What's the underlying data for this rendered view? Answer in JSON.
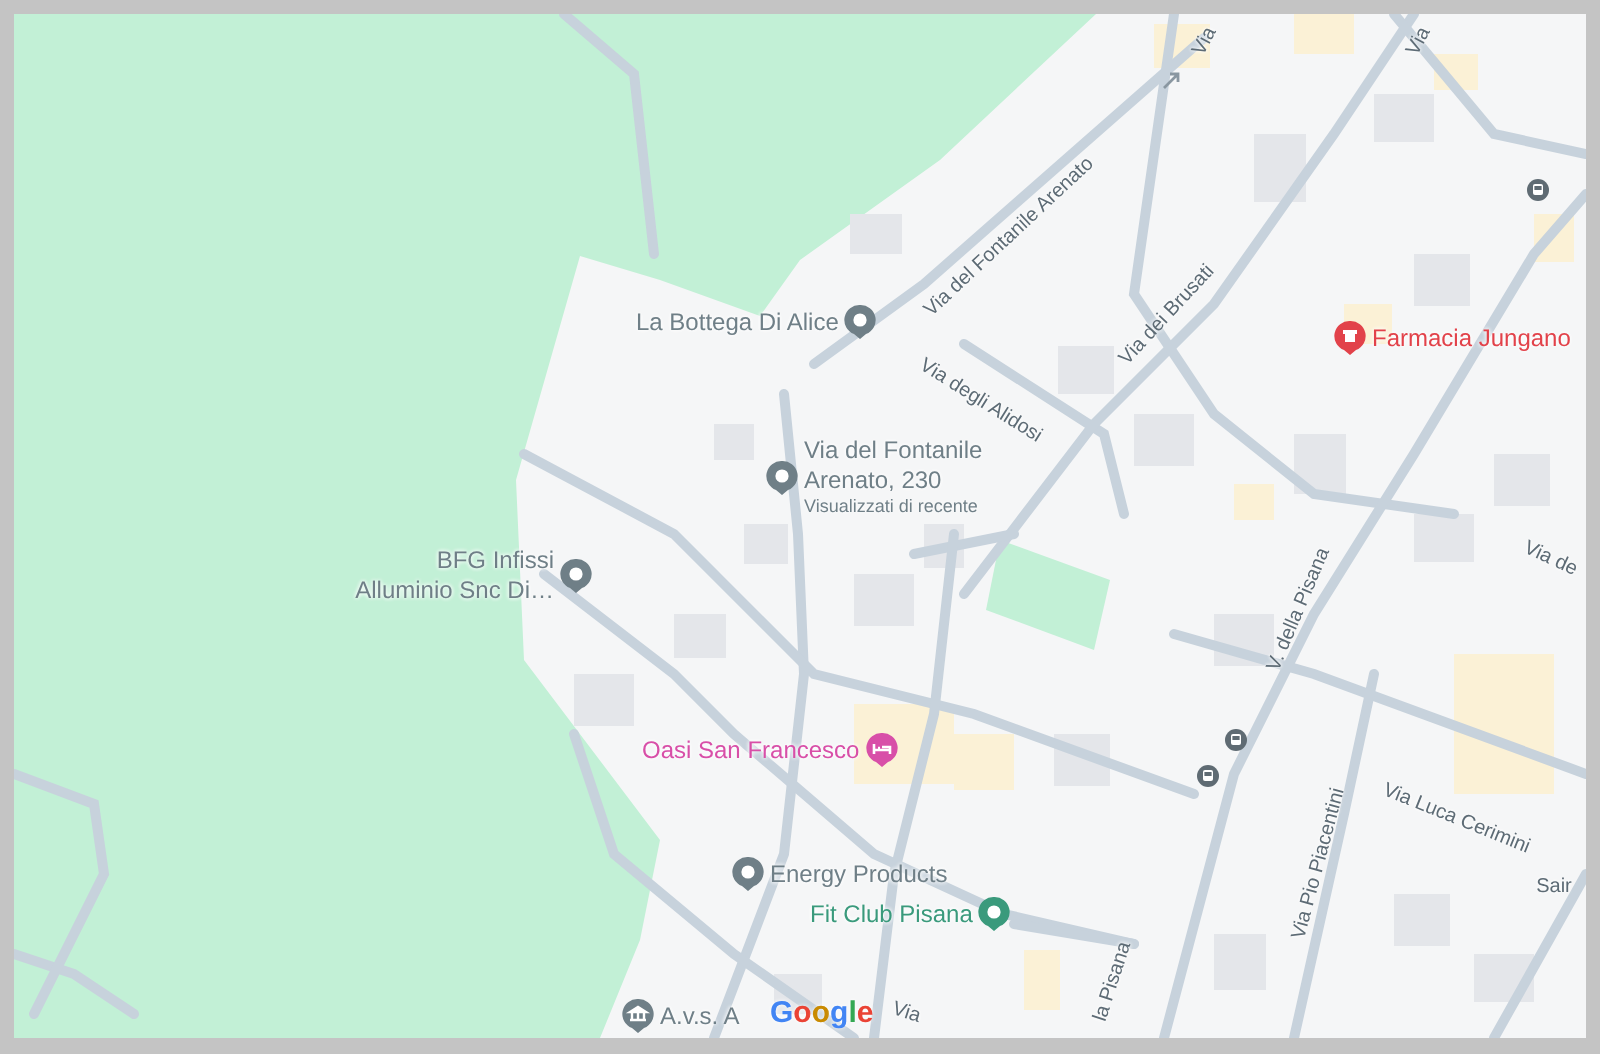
{
  "map": {
    "places": [
      {
        "kind": "pin",
        "name": "La Bottega Di Alice",
        "color": "#6f7f87"
      },
      {
        "kind": "pin",
        "name": "Via del Fontanile Arenato, 230",
        "subtitle": "Visualizzati di recente",
        "color": "#6f7f87"
      },
      {
        "kind": "pin",
        "name": "BFG Infissi Alluminio Snc Di…",
        "color": "#6f7f87"
      },
      {
        "kind": "pharmacy",
        "name": "Farmacia Jungano",
        "color": "#e2424a"
      },
      {
        "kind": "hotel",
        "name": "Oasi San Francesco",
        "color": "#d84fa8"
      },
      {
        "kind": "pin",
        "name": "Energy Products",
        "color": "#6f7f87"
      },
      {
        "kind": "fitness",
        "name": "Fit Club Pisana",
        "color": "#3a9a7c"
      },
      {
        "kind": "landmark",
        "name": "A.v.s. A",
        "color": "#6f7f87"
      }
    ],
    "streets": [
      "Via del Fontanile Arenato",
      "Via degli Alidosi",
      "Via dei Brusati",
      "V. della Pisana",
      "Via Luca Cerimini",
      "Via Pio Piacentini",
      "Via de",
      "Sair",
      "la Pisana",
      "Via",
      "Via",
      "Via"
    ],
    "attribution": "Google"
  }
}
